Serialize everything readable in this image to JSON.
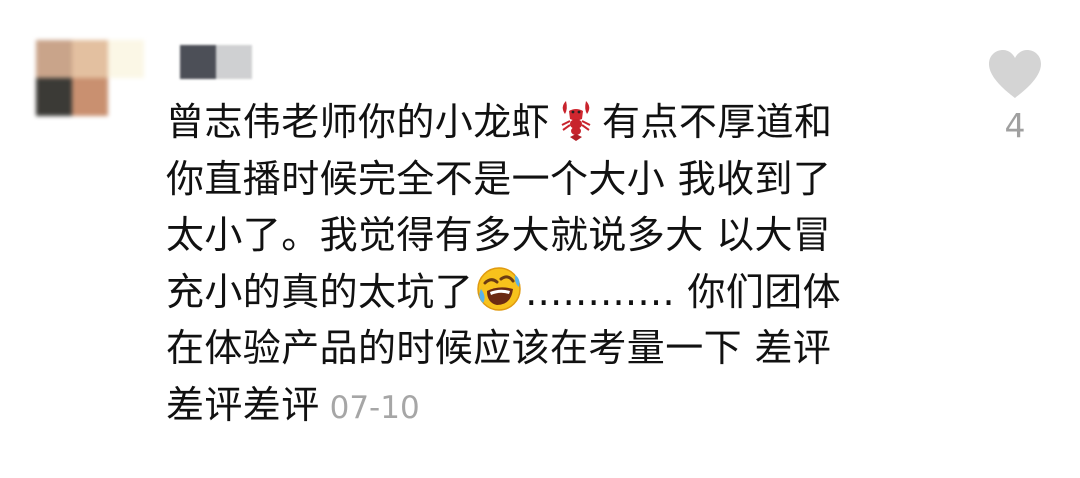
{
  "comment": {
    "lines": [
      {
        "before": "曾志伟老师你的小龙虾",
        "after": "有点不厚道和"
      },
      {
        "text": "你直播时候完全不是一个大小 我收到了"
      },
      {
        "text": "太小了。我觉得有多大就说多大 以大冒"
      },
      {
        "before": "充小的真的太坑了",
        "after": "............ 你们团体"
      },
      {
        "text": "在体验产品的时候应该在考量一下 差评"
      },
      {
        "text": "差评差评"
      }
    ],
    "date": "07-10",
    "emojis": [
      "lobster-emoji",
      "rofl-laughing-emoji"
    ]
  },
  "like": {
    "count": "4",
    "icon": "heart-icon"
  },
  "colors": {
    "text": "#111111",
    "muted": "#a6a6a6",
    "heart": "#d4d4d4"
  }
}
